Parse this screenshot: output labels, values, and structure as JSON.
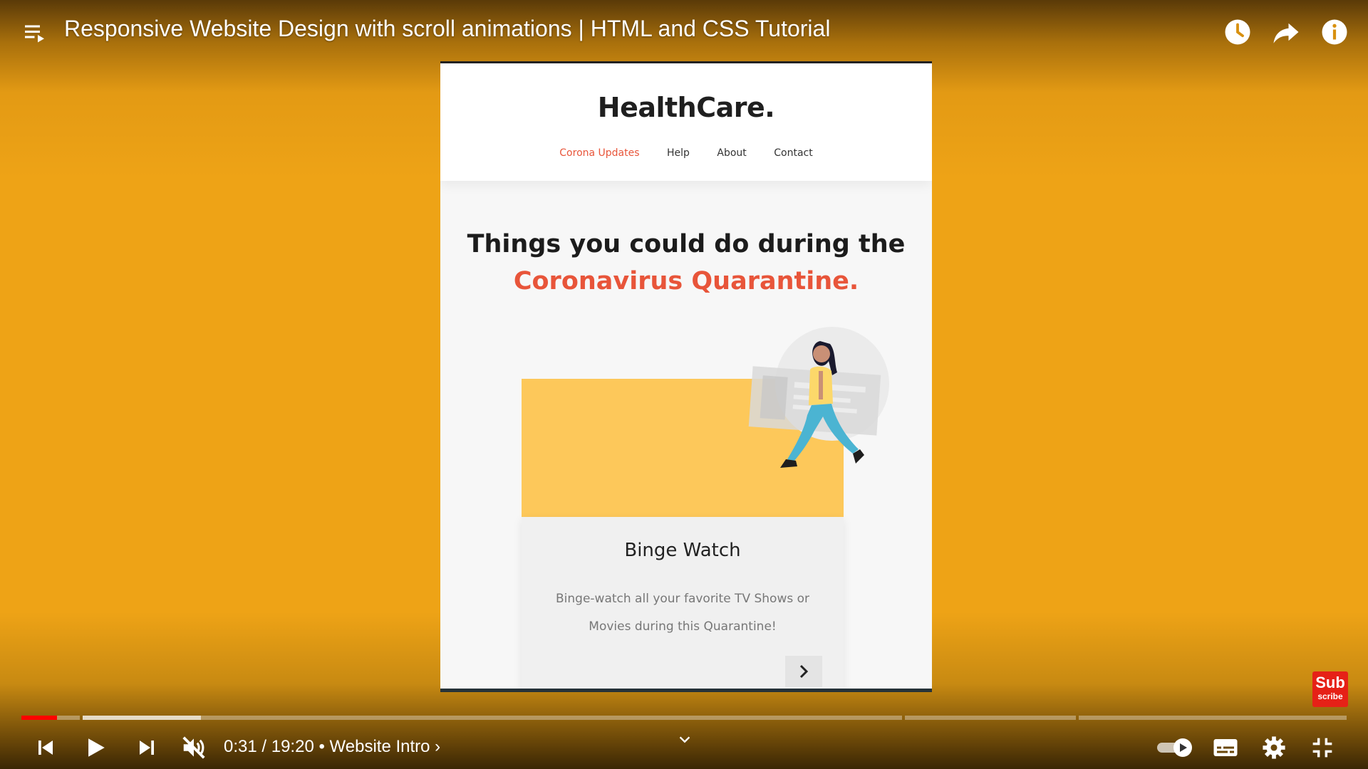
{
  "player": {
    "title": "Responsive Website Design with scroll animations | HTML and CSS Tutorial",
    "time_current": "0:31",
    "time_total": "19:20",
    "chapter": "Website Intro",
    "progress_fraction": 0.027,
    "subscribe_line1": "Sub",
    "subscribe_line2": "scribe",
    "colors": {
      "accent": "#ff0000",
      "background": "#eea316"
    },
    "icons": [
      "playlist-icon",
      "watch-later-icon",
      "share-icon",
      "info-icon",
      "previous-icon",
      "play-icon",
      "next-icon",
      "mute-icon",
      "autoplay-toggle-icon",
      "captions-icon",
      "settings-icon",
      "exit-fullscreen-icon"
    ]
  },
  "site": {
    "brand": "HealthCare.",
    "nav": [
      "Corona Updates",
      "Help",
      "About",
      "Contact"
    ],
    "hero_line1": "Things you could do during the",
    "hero_line2": "Coronavirus Quarantine.",
    "card_title": "Binge Watch",
    "card_text_line1": "Binge-watch all your favorite TV Shows or",
    "card_text_line2": "Movies during this Quarantine!",
    "accent_color": "#e8553a"
  }
}
